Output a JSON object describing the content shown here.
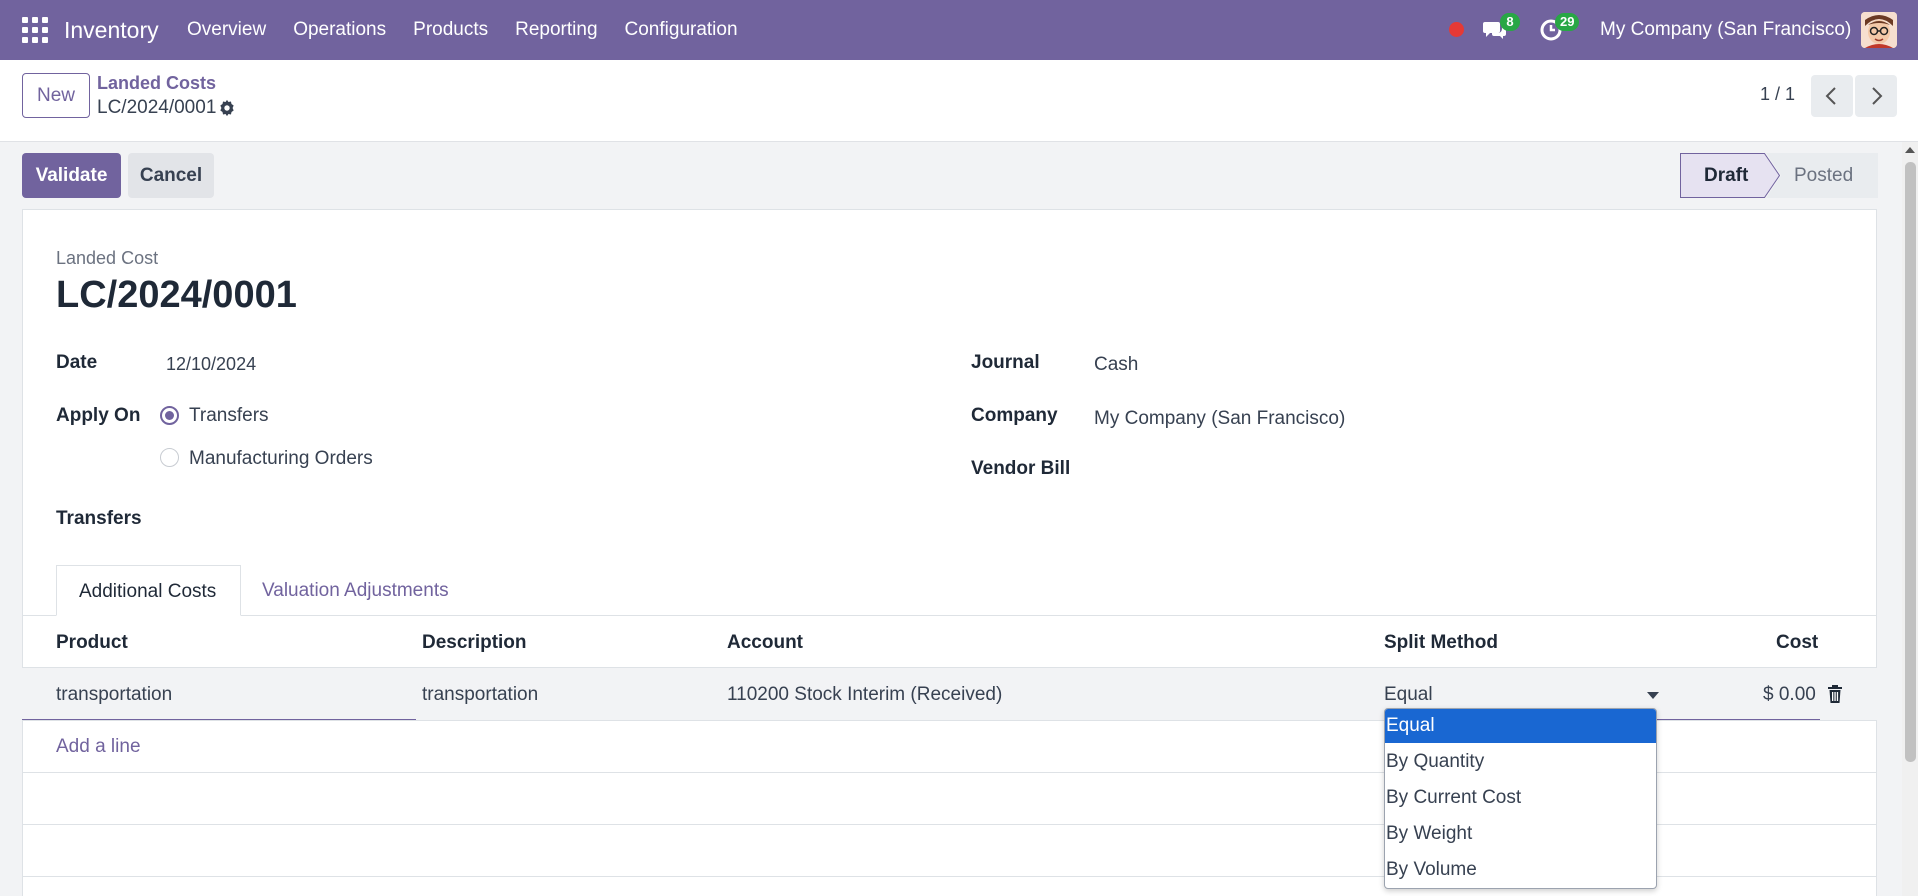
{
  "navbar": {
    "brand": "Inventory",
    "menu": [
      "Overview",
      "Operations",
      "Products",
      "Reporting",
      "Configuration"
    ],
    "chat_count": "8",
    "activity_count": "29",
    "company": "My Company (San Francisco)",
    "colors": {
      "bar": "#71639e",
      "badge": "#28a745",
      "record_dot": "#e53935"
    }
  },
  "control_panel": {
    "new_label": "New",
    "breadcrumb": "Landed Costs",
    "record": "LC/2024/0001",
    "pager": "1 / 1"
  },
  "statusbar": {
    "validate_label": "Validate",
    "cancel_label": "Cancel",
    "stages": [
      "Draft",
      "Posted"
    ],
    "current": "Draft"
  },
  "form": {
    "type_label": "Landed Cost",
    "name": "LC/2024/0001",
    "date_label": "Date",
    "date_value": "12/10/2024",
    "apply_on_label": "Apply On",
    "apply_on_options": [
      "Transfers",
      "Manufacturing Orders"
    ],
    "apply_on_selected": "Transfers",
    "transfers_label": "Transfers",
    "journal_label": "Journal",
    "journal_value": "Cash",
    "company_label": "Company",
    "company_value": "My Company (San Francisco)",
    "vendor_bill_label": "Vendor Bill"
  },
  "tabs": [
    "Additional Costs",
    "Valuation Adjustments"
  ],
  "table": {
    "headers": [
      "Product",
      "Description",
      "Account",
      "Split Method",
      "Cost"
    ],
    "rows": [
      {
        "product": "transportation",
        "description": "transportation",
        "account": "110200 Stock Interim (Received)",
        "split_method": "Equal",
        "cost": "$ 0.00"
      }
    ],
    "add_line": "Add a line"
  },
  "split_dropdown": {
    "options": [
      "Equal",
      "By Quantity",
      "By Current Cost",
      "By Weight",
      "By Volume"
    ],
    "selected": "Equal",
    "highlight_color": "#1967d2"
  }
}
